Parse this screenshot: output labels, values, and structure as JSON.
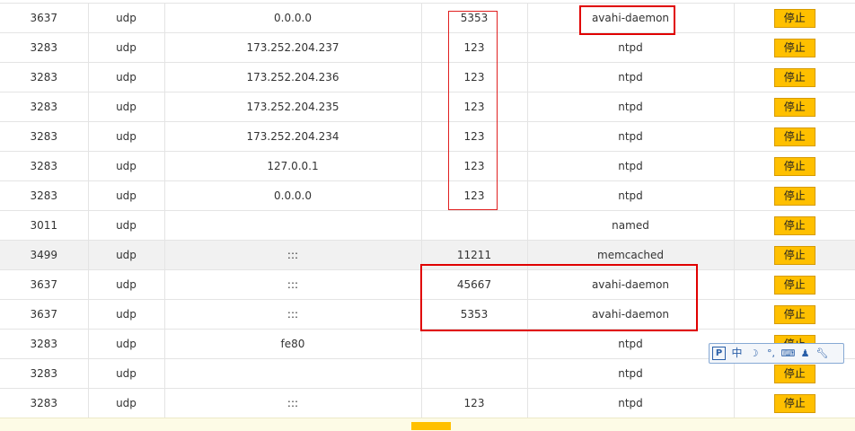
{
  "rows": [
    {
      "pid": "3637",
      "proto": "udp",
      "ip": "0.0.0.0",
      "port": "5353",
      "name": "avahi-daemon",
      "action": "停止"
    },
    {
      "pid": "3283",
      "proto": "udp",
      "ip": "173.252.204.237",
      "port": "123",
      "name": "ntpd",
      "action": "停止"
    },
    {
      "pid": "3283",
      "proto": "udp",
      "ip": "173.252.204.236",
      "port": "123",
      "name": "ntpd",
      "action": "停止"
    },
    {
      "pid": "3283",
      "proto": "udp",
      "ip": "173.252.204.235",
      "port": "123",
      "name": "ntpd",
      "action": "停止"
    },
    {
      "pid": "3283",
      "proto": "udp",
      "ip": "173.252.204.234",
      "port": "123",
      "name": "ntpd",
      "action": "停止"
    },
    {
      "pid": "3283",
      "proto": "udp",
      "ip": "127.0.0.1",
      "port": "123",
      "name": "ntpd",
      "action": "停止"
    },
    {
      "pid": "3283",
      "proto": "udp",
      "ip": "0.0.0.0",
      "port": "123",
      "name": "ntpd",
      "action": "停止"
    },
    {
      "pid": "3011",
      "proto": "udp",
      "ip": "",
      "port": "",
      "name": "named",
      "action": "停止"
    },
    {
      "pid": "3499",
      "proto": "udp",
      "ip": ":::",
      "port": "11211",
      "name": "memcached",
      "action": "停止"
    },
    {
      "pid": "3637",
      "proto": "udp",
      "ip": ":::",
      "port": "45667",
      "name": "avahi-daemon",
      "action": "停止"
    },
    {
      "pid": "3637",
      "proto": "udp",
      "ip": ":::",
      "port": "5353",
      "name": "avahi-daemon",
      "action": "停止"
    },
    {
      "pid": "3283",
      "proto": "udp",
      "ip": "fe80",
      "port": "",
      "name": "ntpd",
      "action": "停止"
    },
    {
      "pid": "3283",
      "proto": "udp",
      "ip": "",
      "port": "",
      "name": "ntpd",
      "action": "停止"
    },
    {
      "pid": "3283",
      "proto": "udp",
      "ip": ":::",
      "port": "123",
      "name": "ntpd",
      "action": "停止"
    }
  ],
  "highlighted_row": 8,
  "ime_toolbar": {
    "zh_label": "中",
    "icons": [
      "ime-p-icon",
      "chinese-mode-icon",
      "moon-icon",
      "punctuation-icon",
      "keyboard-icon",
      "user-icon",
      "wrench-icon"
    ]
  },
  "colors": {
    "stop_button": "#ffc000",
    "annotation": "#e00000"
  }
}
